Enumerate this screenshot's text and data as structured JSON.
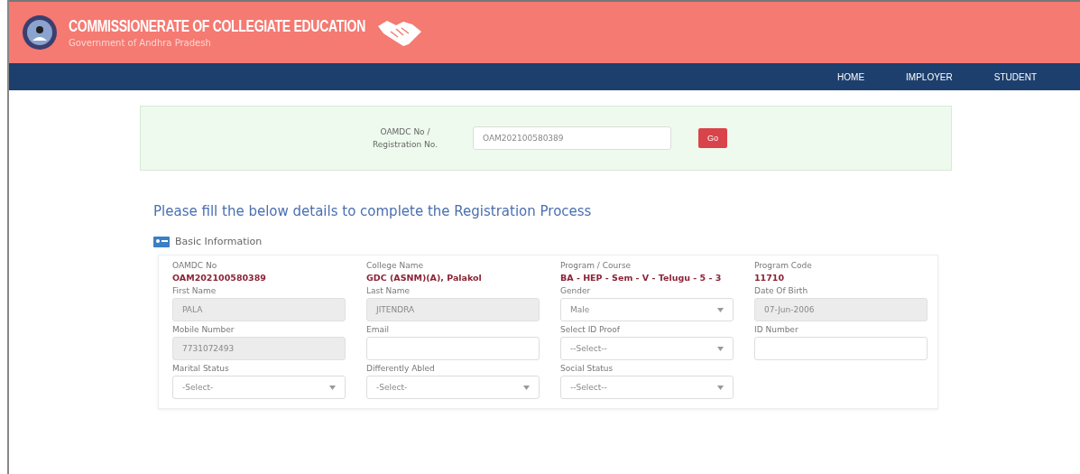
{
  "header": {
    "title": "COMMISSIONERATE OF COLLEGIATE EDUCATION",
    "subtitle": "Government of Andhra Pradesh"
  },
  "nav": [
    {
      "label": "HOME"
    },
    {
      "label": "IMPLOYER"
    },
    {
      "label": "STUDENT"
    }
  ],
  "search": {
    "label": "OAMDC No / Registration No.",
    "value": "OAM202100580389",
    "button": "Go"
  },
  "heading": "Please fill the below details to complete the Registration Process",
  "section": "Basic Information",
  "fields": [
    {
      "kind": "info",
      "label": "OAMDC No",
      "value": "OAM202100580389"
    },
    {
      "kind": "info",
      "label": "College Name",
      "value": "GDC (ASNM)(A), Palakol"
    },
    {
      "kind": "info",
      "label": "Program / Course",
      "value": "BA - HEP - Sem - V - Telugu - 5 - 3"
    },
    {
      "kind": "info",
      "label": "Program Code",
      "value": "11710"
    },
    {
      "kind": "text",
      "label": "First Name",
      "value": "PALA",
      "disabled": true
    },
    {
      "kind": "text",
      "label": "Last Name",
      "value": "JITENDRA",
      "disabled": true
    },
    {
      "kind": "select",
      "label": "Gender",
      "value": "Male"
    },
    {
      "kind": "text",
      "label": "Date Of Birth",
      "value": "07-Jun-2006",
      "disabled": true
    },
    {
      "kind": "text",
      "label": "Mobile Number",
      "value": "7731072493",
      "disabled": true
    },
    {
      "kind": "text",
      "label": "Email",
      "disabled": false
    },
    {
      "kind": "select",
      "label": "Select ID Proof",
      "value": "--Select--"
    },
    {
      "kind": "text",
      "label": "ID Number",
      "disabled": false
    },
    {
      "kind": "select",
      "label": "Marital Status",
      "value": "-Select-"
    },
    {
      "kind": "select",
      "label": "Differently Abled",
      "value": "-Select-"
    },
    {
      "kind": "select",
      "label": "Social Status",
      "value": "--Select--"
    }
  ]
}
